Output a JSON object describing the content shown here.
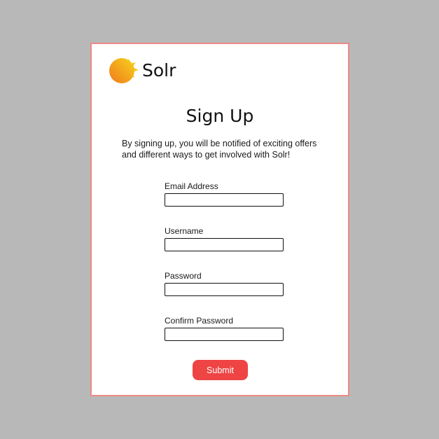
{
  "brand": {
    "name": "Solr",
    "icon": "sun-icon",
    "colors": {
      "sun_start": "#f7d21c",
      "sun_end": "#f07a1e"
    }
  },
  "signup": {
    "title": "Sign Up",
    "intro": "By signing up, you will be notified of exciting offers and different ways to get involved with Solr!",
    "fields": [
      {
        "label": "Email Address",
        "value": "",
        "placeholder": ""
      },
      {
        "label": "Username",
        "value": "",
        "placeholder": ""
      },
      {
        "label": "Password",
        "value": "",
        "placeholder": ""
      },
      {
        "label": "Confirm Password",
        "value": "",
        "placeholder": ""
      }
    ],
    "submit_label": "Submit"
  },
  "colors": {
    "page_background": "#b8b8b8",
    "card_border": "#ee8a85",
    "submit_background": "#ee4444"
  }
}
